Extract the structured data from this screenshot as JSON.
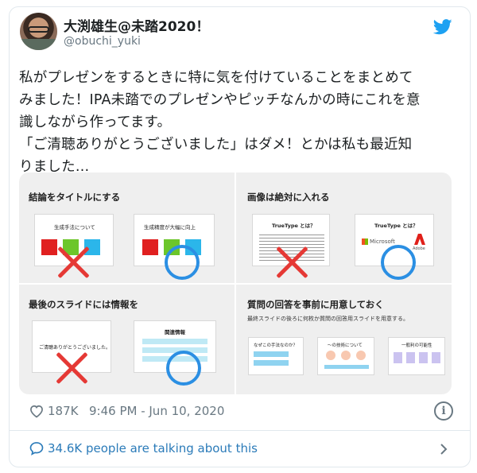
{
  "tweet": {
    "author_name": "大渕雄生@未踏2020！",
    "author_handle": "@obuchi_yuki",
    "text_lines": [
      "私がプレゼンをするときに特に気を付けていることをまとめて",
      "みました！IPA未踏でのプレゼンやピッチなんかの時にこれを意",
      "識しながら作ってます。",
      "「ご清聴ありがとうございました」はダメ！とかは私も最近知",
      "りました…"
    ],
    "likes": "187K",
    "timestamp": "9:46 PM - Jun 10, 2020",
    "conversation_link": "34.6K people are talking about this"
  },
  "media": {
    "panels": [
      {
        "title": "結論をタイトルにする",
        "bad_slide_label": "生成手法について",
        "good_slide_label": "生成精度が大幅に向上"
      },
      {
        "title": "画像は絶対に入れる",
        "bad_slide_label": "TrueType とは？",
        "good_slide_label": "TrueType とは？",
        "logo_left": "Microsoft",
        "logo_right": "Adobe"
      },
      {
        "title": "最後のスライドには情報を",
        "bad_slide_label": "ご清聴ありがとうございました。",
        "good_slide_label": "関連情報"
      },
      {
        "title": "質問の回答を事前に用意しておく",
        "subtitle": "最終スライドの後ろに何枚か質問の回答用スライドを用意する。",
        "slide_labels": [
          "なぜこの手法なのか？",
          "〜の技術について",
          "一般利の可能性"
        ]
      }
    ]
  },
  "colors": {
    "twitter_blue": "#1da1f2",
    "link_blue": "#2b7bb9",
    "muted": "#697882",
    "bad_mark": "#e53935",
    "good_mark": "#2b8fe3"
  },
  "icons": [
    "twitter-bird-icon",
    "heart-icon",
    "info-icon",
    "comment-bubble-icon",
    "chevron-right-icon"
  ]
}
